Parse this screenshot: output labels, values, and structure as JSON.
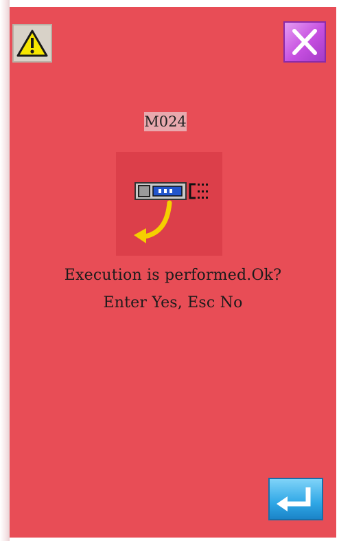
{
  "dialog": {
    "code": "M024",
    "line1": "Execution is performed.Ok?",
    "line2": "Enter Yes, Esc No"
  },
  "icons": {
    "warning": "warning-triangle-icon",
    "close": "close-x-icon",
    "enter": "enter-return-icon",
    "illustration": "execution-switch-icon"
  },
  "colors": {
    "background": "#e84d56",
    "close_button": "#c64fe0",
    "enter_button": "#2fa7e6",
    "warning_yellow": "#f7e600"
  }
}
